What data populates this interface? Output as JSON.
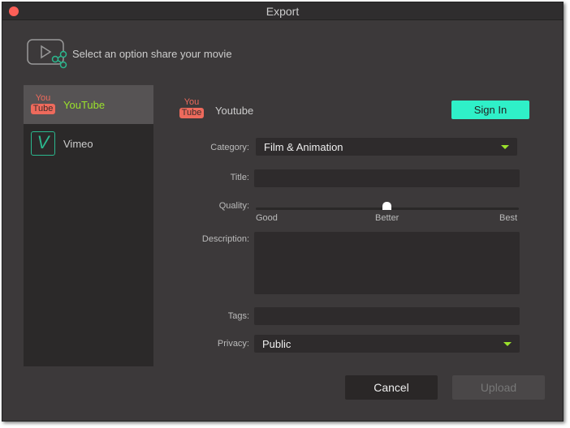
{
  "window": {
    "title": "Export"
  },
  "header": {
    "text": "Select an option share your movie"
  },
  "sidebar": {
    "items": [
      {
        "label": "YouTube",
        "selected": true
      },
      {
        "label": "Vimeo"
      }
    ]
  },
  "youtube_logo": {
    "you": "You",
    "tube": "Tube"
  },
  "service": {
    "name": "Youtube",
    "sign_in": "Sign In"
  },
  "form": {
    "category_label": "Category:",
    "category_value": "Film & Animation",
    "title_label": "Title:",
    "title_value": "",
    "quality_label": "Quality:",
    "quality_ticks": [
      "Good",
      "Better",
      "Best"
    ],
    "quality_value": "Better",
    "description_label": "Description:",
    "tags_label": "Tags:",
    "privacy_label": "Privacy:",
    "privacy_value": "Public"
  },
  "footer": {
    "cancel": "Cancel",
    "upload": "Upload"
  },
  "colors": {
    "accent": "#2ff0c8",
    "selected_text": "#9be22c",
    "youtube": "#ee6a5c"
  }
}
